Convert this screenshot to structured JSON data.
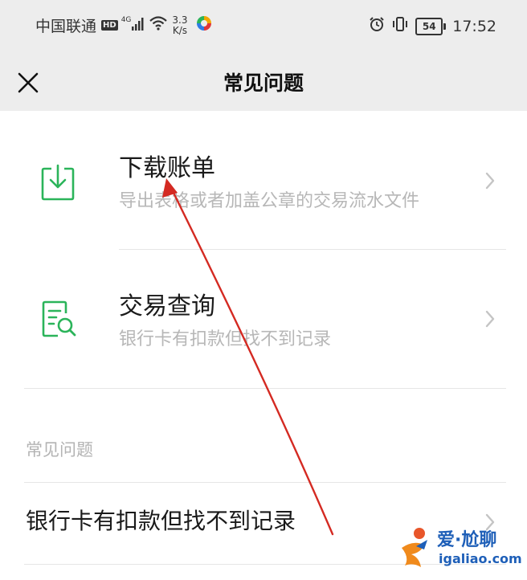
{
  "status_bar": {
    "carrier": "中国联通",
    "hd": "HD",
    "network": "4G",
    "speed_value": "3.3",
    "speed_unit": "K/s",
    "battery": "54",
    "time": "17:52"
  },
  "header": {
    "title": "常见问题"
  },
  "services": [
    {
      "title": "下载账单",
      "subtitle": "导出表格或者加盖公章的交易流水文件",
      "icon": "download-icon"
    },
    {
      "title": "交易查询",
      "subtitle": "银行卡有扣款但找不到记录",
      "icon": "document-search-icon"
    }
  ],
  "faq": {
    "section_label": "常见问题",
    "items": [
      "银行卡有扣款但找不到记录"
    ]
  },
  "watermark": {
    "brand": "爱·尬聊",
    "domain": "igaliao.com"
  },
  "colors": {
    "accent_green": "#2bb45a",
    "header_bg": "#ededed",
    "subtitle_gray": "#b7b7b7",
    "arrow_red": "#d42a22",
    "watermark_blue": "#1e5fb8"
  }
}
